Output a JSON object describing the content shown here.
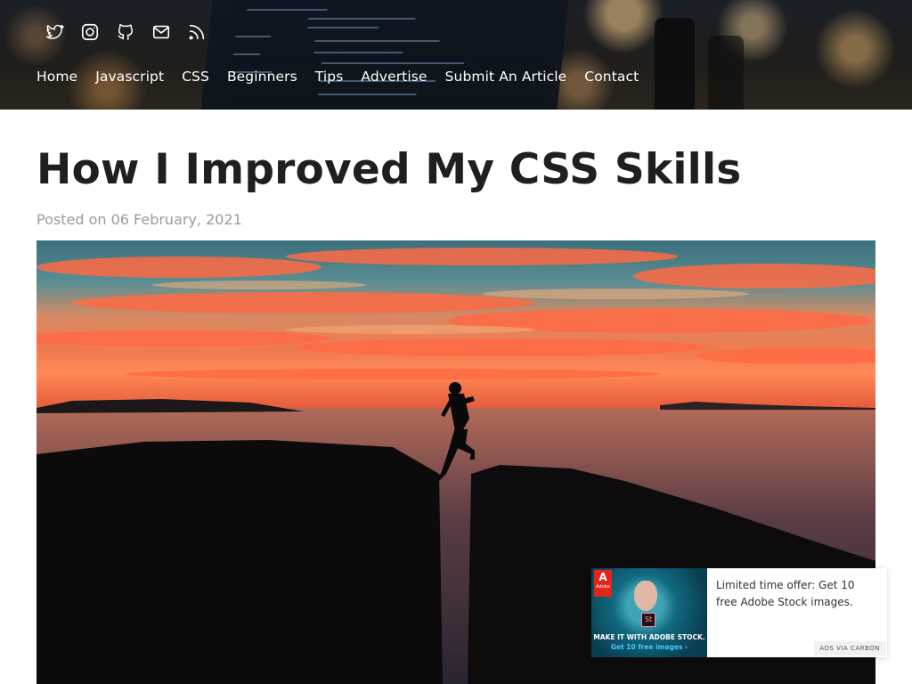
{
  "header": {
    "social_icons": [
      "twitter-icon",
      "instagram-icon",
      "github-icon",
      "mail-icon",
      "rss-icon"
    ],
    "nav": [
      {
        "label": "Home"
      },
      {
        "label": "Javascript"
      },
      {
        "label": "CSS"
      },
      {
        "label": "Beginners"
      },
      {
        "label": "Tips"
      },
      {
        "label": "Advertise"
      },
      {
        "label": "Submit An Article"
      },
      {
        "label": "Contact"
      }
    ]
  },
  "article": {
    "title": "How I Improved My CSS Skills",
    "posted_on": "Posted on 06 February, 2021"
  },
  "ad": {
    "brand": "Adobe",
    "badge": "St",
    "caption_1": "MAKE IT WITH ADOBE STOCK.",
    "caption_2": "Get 10 free images ›",
    "text": "Limited time offer: Get 10 free Adobe Stock images.",
    "via": "ADS VIA CARBON"
  },
  "colors": {
    "title": "#1f1f1f",
    "meta": "#9a9a9a",
    "nav": "#ffffff",
    "adobe_red": "#e1251b"
  }
}
